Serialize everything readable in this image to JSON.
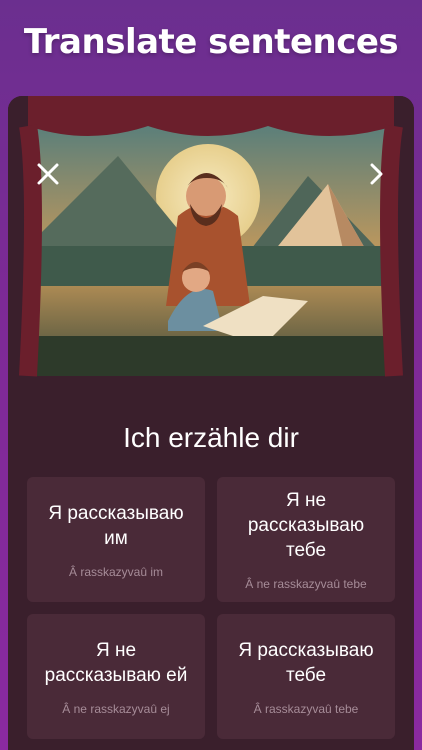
{
  "header": {
    "title": "Translate sentences"
  },
  "card": {
    "close_icon": "close-icon",
    "next_icon": "chevron-right-icon",
    "prompt": "Ich erzähle dir",
    "options": [
      {
        "text": "Я рассказываю им",
        "translit": "Â rasskazyvaû im"
      },
      {
        "text": "Я не рассказываю тебе",
        "translit": "Â ne rasskazyvaû tebe"
      },
      {
        "text": "Я не рассказываю ей",
        "translit": "Â ne rasskazyvaû ej"
      },
      {
        "text": "Я рассказываю тебе",
        "translit": "Â rasskazyvaû tebe"
      }
    ]
  },
  "colors": {
    "background": "#7d2a96",
    "card": "#3a1f2c",
    "option": "#4a2a38",
    "text": "#ffffff",
    "muted_text": "#a68c98"
  }
}
